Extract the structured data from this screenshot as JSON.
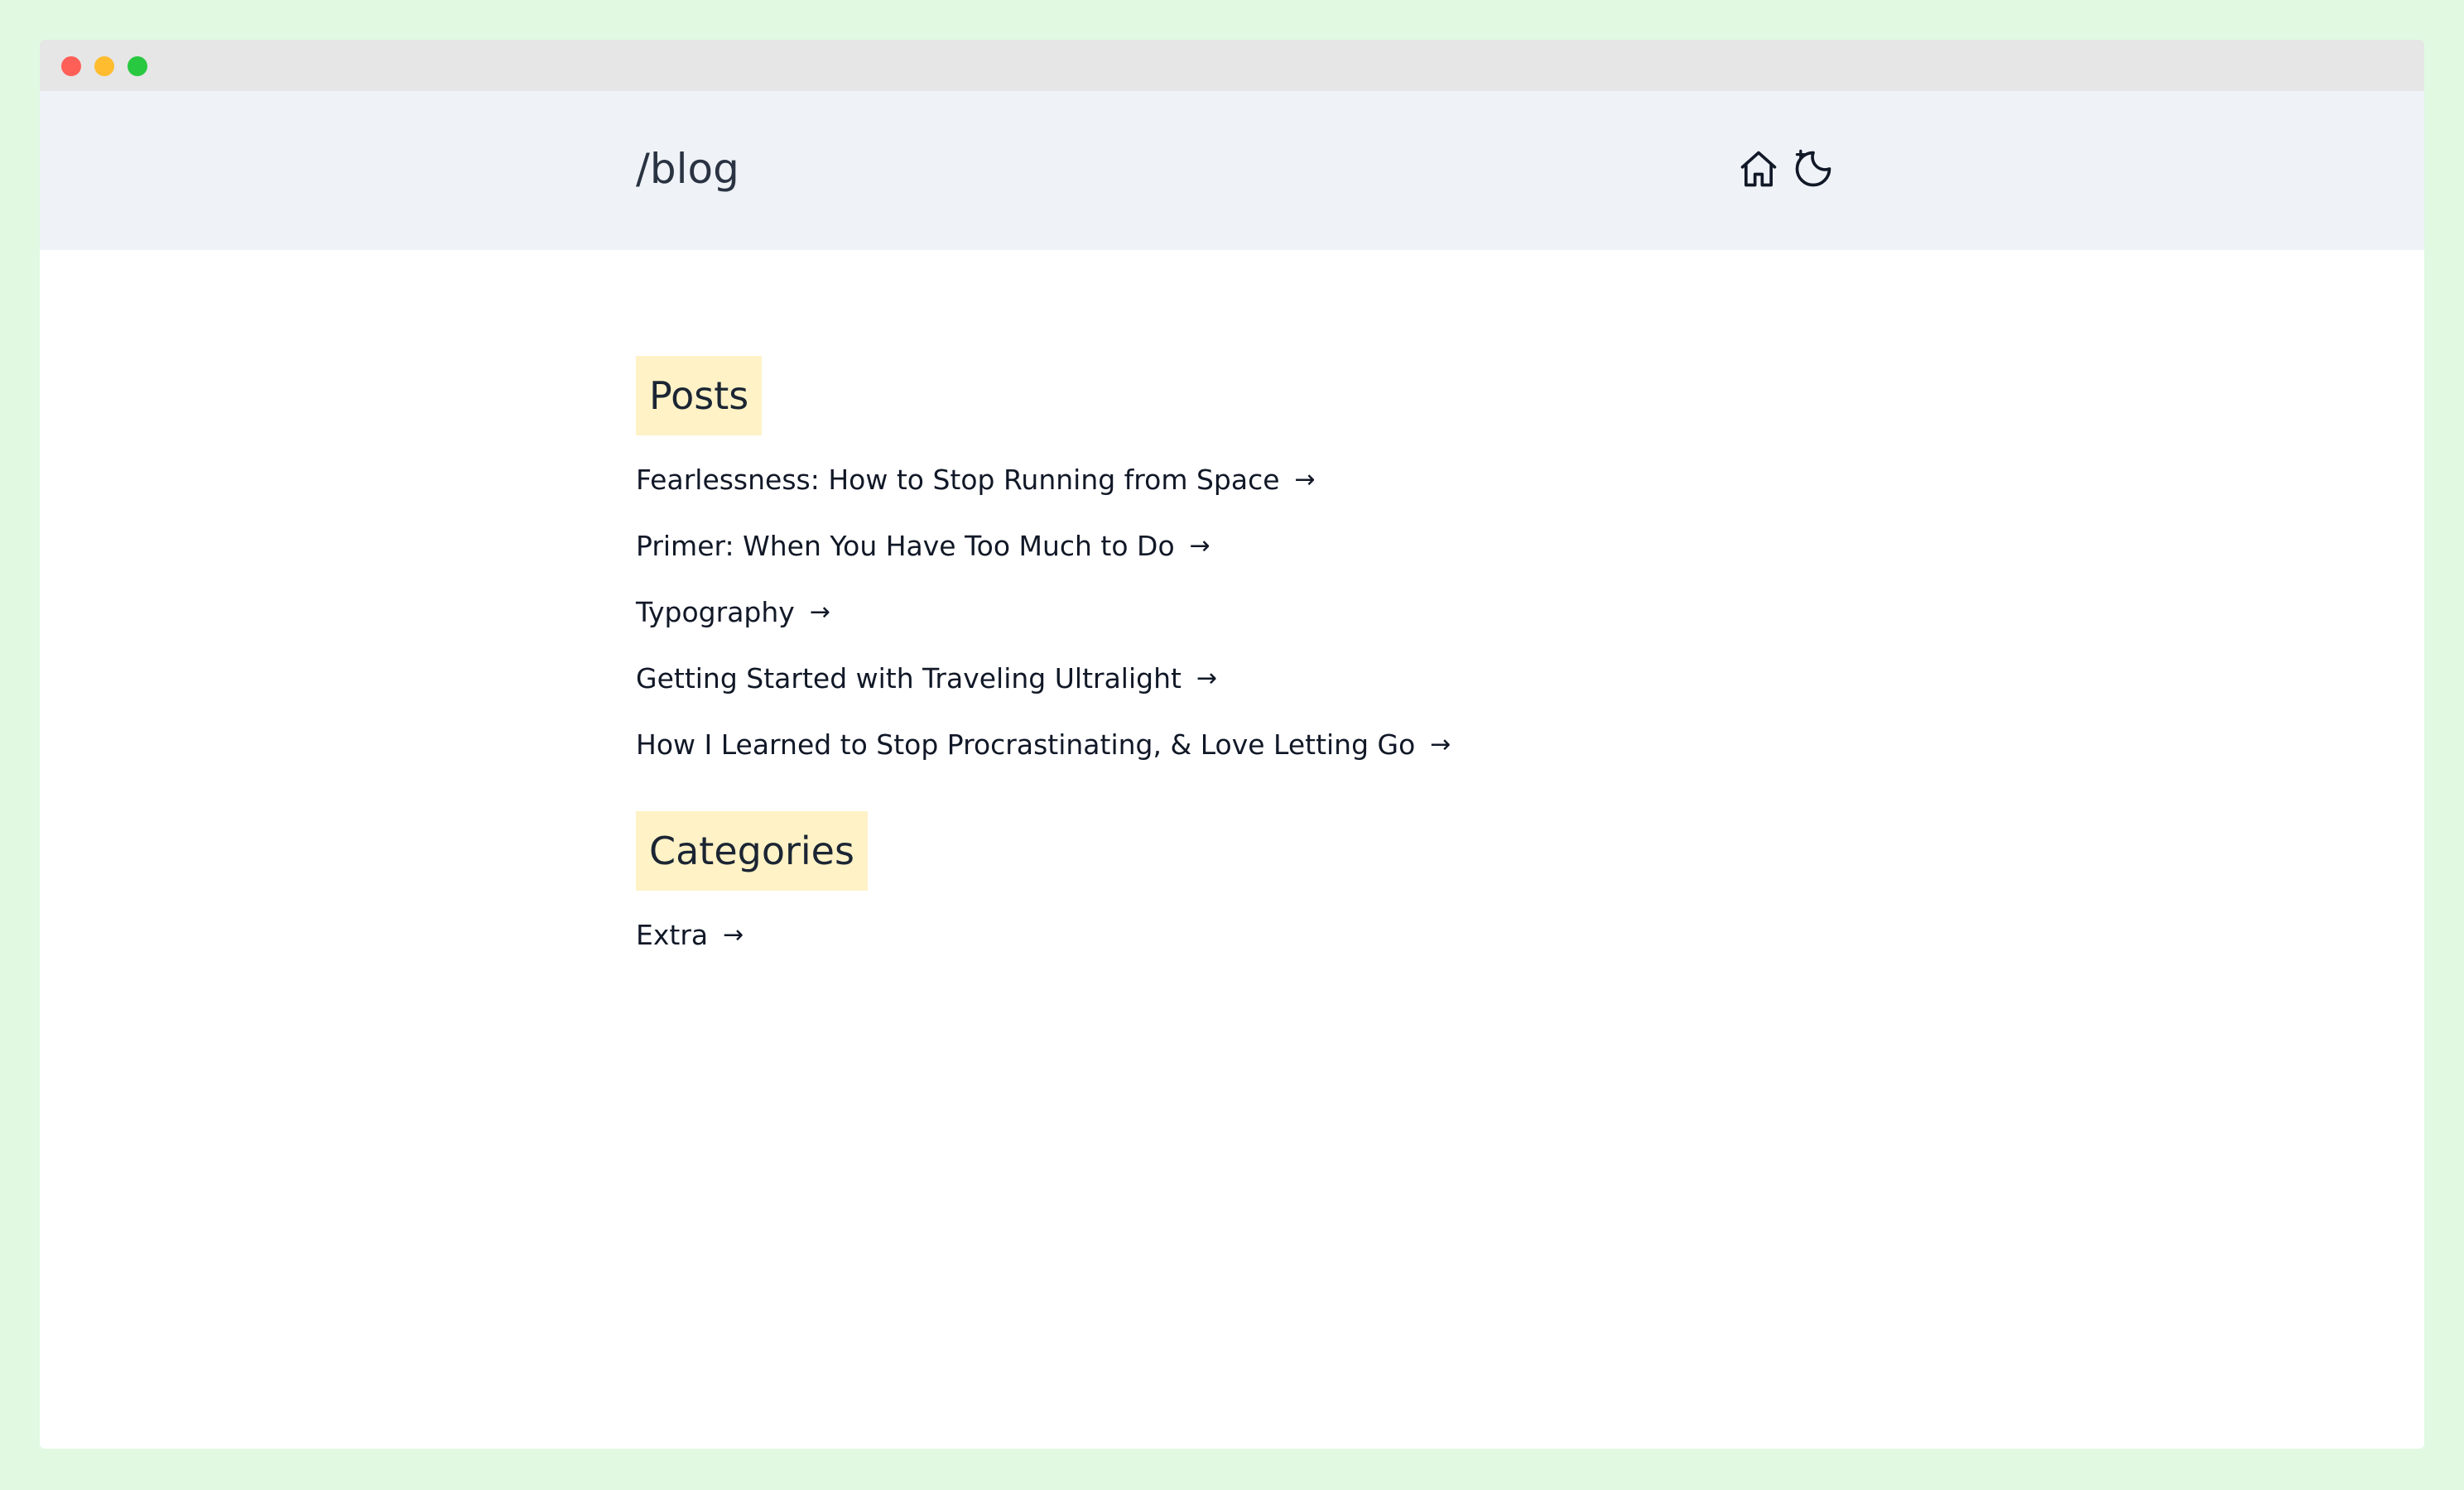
{
  "header": {
    "title": "/blog"
  },
  "icons": {
    "home": "home-icon",
    "theme": "moon-sparkle-icon"
  },
  "posts": {
    "heading": "Posts",
    "items": [
      {
        "label": "Fearlessness: How to Stop Running from Space"
      },
      {
        "label": "Primer: When You Have Too Much to Do"
      },
      {
        "label": "Typography"
      },
      {
        "label": "Getting Started with Traveling Ultralight"
      },
      {
        "label": "How I Learned to Stop Procrastinating, & Love Letting Go"
      }
    ]
  },
  "categories": {
    "heading": "Categories",
    "items": [
      {
        "label": "Extra"
      }
    ]
  },
  "arrow_glyph": "→",
  "colors": {
    "page_background": "#e1f8e1",
    "header_background": "#eff3f8",
    "heading_highlight": "#fef2c6",
    "text": "#111827"
  }
}
